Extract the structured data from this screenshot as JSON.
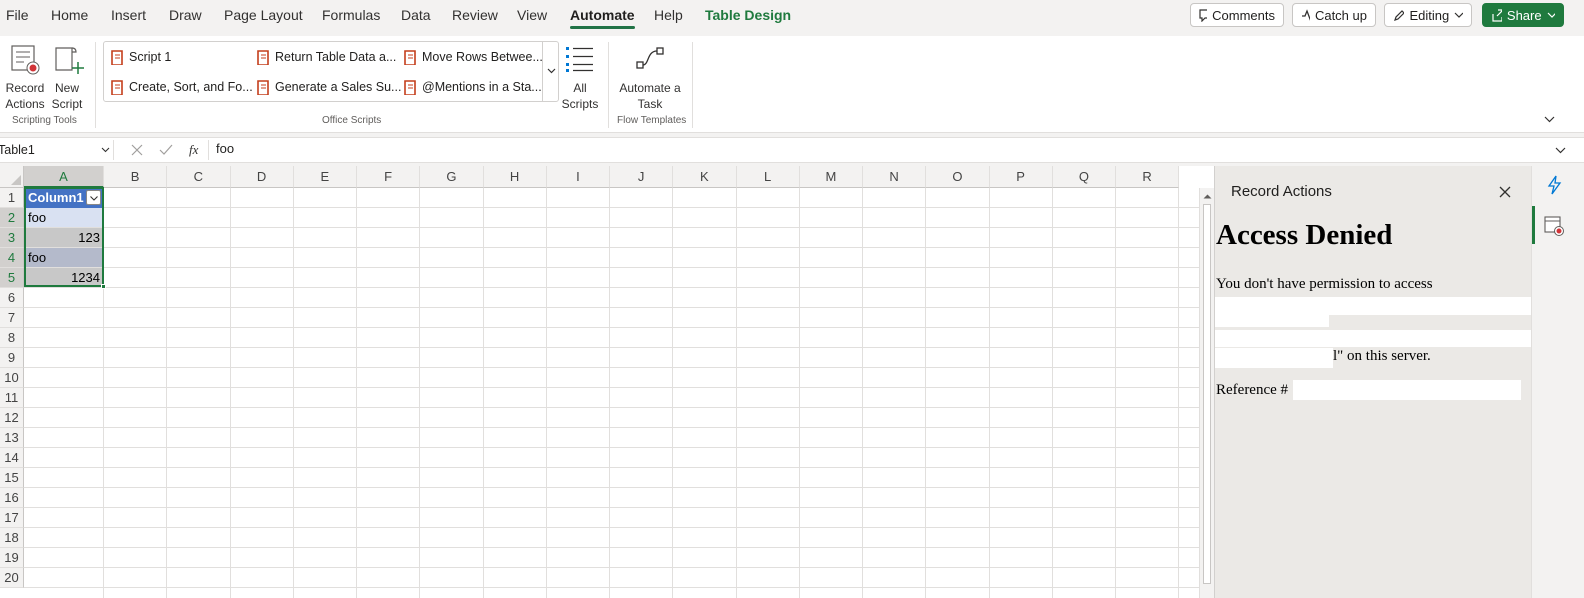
{
  "menu": {
    "items": [
      "File",
      "Home",
      "Insert",
      "Draw",
      "Page Layout",
      "Formulas",
      "Data",
      "Review",
      "View",
      "Automate",
      "Help",
      "Table Design"
    ],
    "active": "Automate"
  },
  "top_buttons": {
    "comments": "Comments",
    "catchup": "Catch up",
    "editing": "Editing",
    "share": "Share"
  },
  "ribbon": {
    "record_actions": [
      "Record",
      "Actions"
    ],
    "new_script": [
      "New",
      "Script"
    ],
    "scripting_tools": "Scripting Tools",
    "scripts": [
      "Script 1",
      "Return Table Data a...",
      "Move Rows Betwee...",
      "Create, Sort, and Fo...",
      "Generate a Sales Su...",
      "@Mentions in a Sta..."
    ],
    "all_scripts": [
      "All",
      "Scripts"
    ],
    "office_scripts": "Office Scripts",
    "automate_task": [
      "Automate a",
      "Task"
    ],
    "flow_templates": "Flow Templates"
  },
  "formula_bar": {
    "name_box": "Table1",
    "fx": "fx",
    "value": "foo"
  },
  "grid": {
    "columns": [
      "A",
      "B",
      "C",
      "D",
      "E",
      "F",
      "G",
      "H",
      "I",
      "J",
      "K",
      "L",
      "M",
      "N",
      "O",
      "P",
      "Q",
      "R"
    ],
    "rows": [
      "1",
      "2",
      "3",
      "4",
      "5",
      "6",
      "7",
      "8",
      "9",
      "10",
      "11",
      "12",
      "13",
      "14",
      "15",
      "16",
      "17",
      "18",
      "19",
      "20"
    ],
    "header_cell": "Column1",
    "cells": [
      "foo",
      "123",
      "foo",
      "1234"
    ]
  },
  "pane": {
    "title": "Record Actions",
    "heading": "Access Denied",
    "message_line1": "You don't have permission to access",
    "message_tail": "l\" on this server.",
    "reference_label": "Reference #"
  },
  "colors": {
    "accent": "#1f7a3e",
    "table_header": "#4472c4",
    "band_light": "#d9e1f2"
  }
}
